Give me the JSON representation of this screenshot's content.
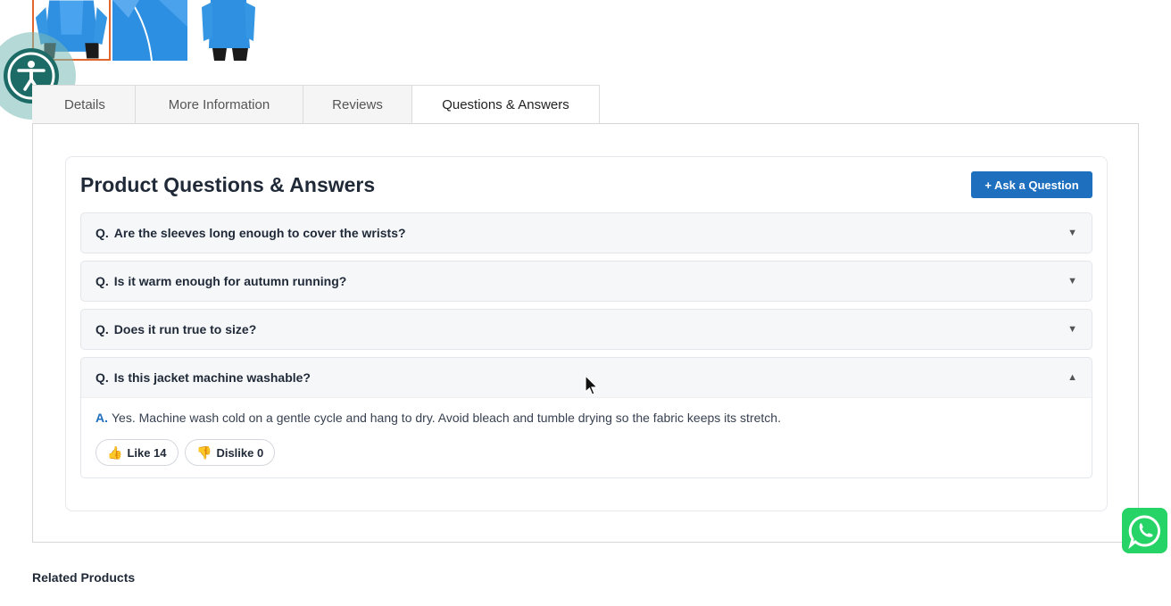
{
  "thumbnails": [
    {
      "name": "thumb-front",
      "active": true
    },
    {
      "name": "thumb-closeup",
      "active": false
    },
    {
      "name": "thumb-back",
      "active": false
    }
  ],
  "tabs": [
    {
      "label": "Details"
    },
    {
      "label": "More Information"
    },
    {
      "label": "Reviews"
    },
    {
      "label": "Questions & Answers",
      "active": true
    }
  ],
  "qa": {
    "title": "Product Questions & Answers",
    "ask_button": "+ Ask a Question",
    "items": [
      {
        "prefix": "Q.",
        "question": "Are the sleeves long enough to cover the wrists?",
        "arrow": "▼"
      },
      {
        "prefix": "Q.",
        "question": "Is it warm enough for autumn running?",
        "arrow": "▼"
      },
      {
        "prefix": "Q.",
        "question": "Does it run true to size?",
        "arrow": "▼"
      },
      {
        "prefix": "Q.",
        "question": "Is this jacket machine washable?",
        "arrow": "▲",
        "answer_prefix": "A.",
        "answer": "Yes. Machine wash cold on a gentle cycle and hang to dry. Avoid bleach and tumble drying so the fabric keeps its stretch.",
        "like": "Like 14",
        "dislike": "Dislike 0"
      }
    ]
  },
  "related_title": "Related Products",
  "colors": {
    "accent": "#1f6fbf",
    "thumb_active_border": "#e2662a",
    "whatsapp": "#25d366",
    "accessibility": "#1d6b66"
  },
  "icons": {
    "accessibility": "accessibility-icon",
    "whatsapp": "whatsapp-icon",
    "like": "thumbs-up-icon",
    "dislike": "thumbs-down-icon",
    "cursor": "mouse-pointer-icon"
  }
}
